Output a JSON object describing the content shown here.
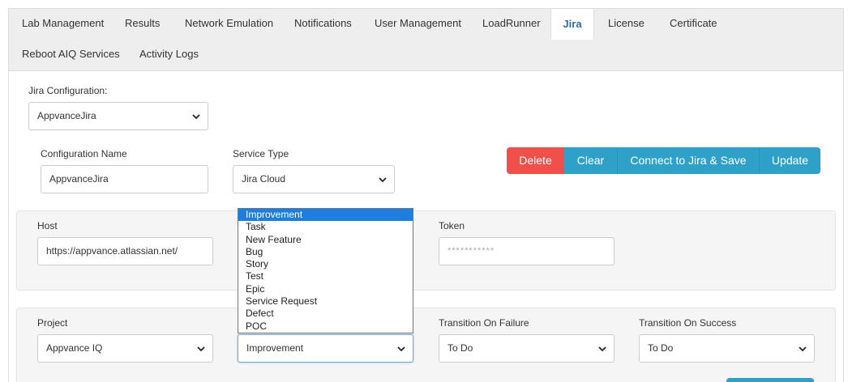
{
  "tabs": [
    {
      "label": "Lab Management"
    },
    {
      "label": "Results"
    },
    {
      "label": "Network Emulation"
    },
    {
      "label": "Notifications"
    },
    {
      "label": "User Management"
    },
    {
      "label": "LoadRunner"
    },
    {
      "label": "Jira"
    },
    {
      "label": "License"
    },
    {
      "label": "Certificate"
    },
    {
      "label": "Reboot AIQ Services"
    },
    {
      "label": "Activity Logs"
    }
  ],
  "jira_config": {
    "label": "Jira Configuration:",
    "selected": "AppvanceJira"
  },
  "config_name": {
    "label": "Configuration Name",
    "value": "AppvanceJira"
  },
  "service_type": {
    "label": "Service Type",
    "selected": "Jira Cloud"
  },
  "actions": {
    "delete": "Delete",
    "clear": "Clear",
    "connect": "Connect to Jira & Save",
    "update": "Update"
  },
  "host": {
    "label": "Host",
    "value": "https://appvance.atlassian.net/"
  },
  "token": {
    "label": "Token",
    "placeholder": "***********"
  },
  "project": {
    "label": "Project",
    "selected": "Appvance IQ"
  },
  "issue_type": {
    "selected": "Improvement",
    "options": [
      "Improvement",
      "Task",
      "New Feature",
      "Bug",
      "Story",
      "Test",
      "Epic",
      "Service Request",
      "Defect",
      "POC"
    ]
  },
  "transition_failure": {
    "label": "Transition On Failure",
    "selected": "To Do"
  },
  "transition_success": {
    "label": "Transition On Success",
    "selected": "To Do"
  }
}
